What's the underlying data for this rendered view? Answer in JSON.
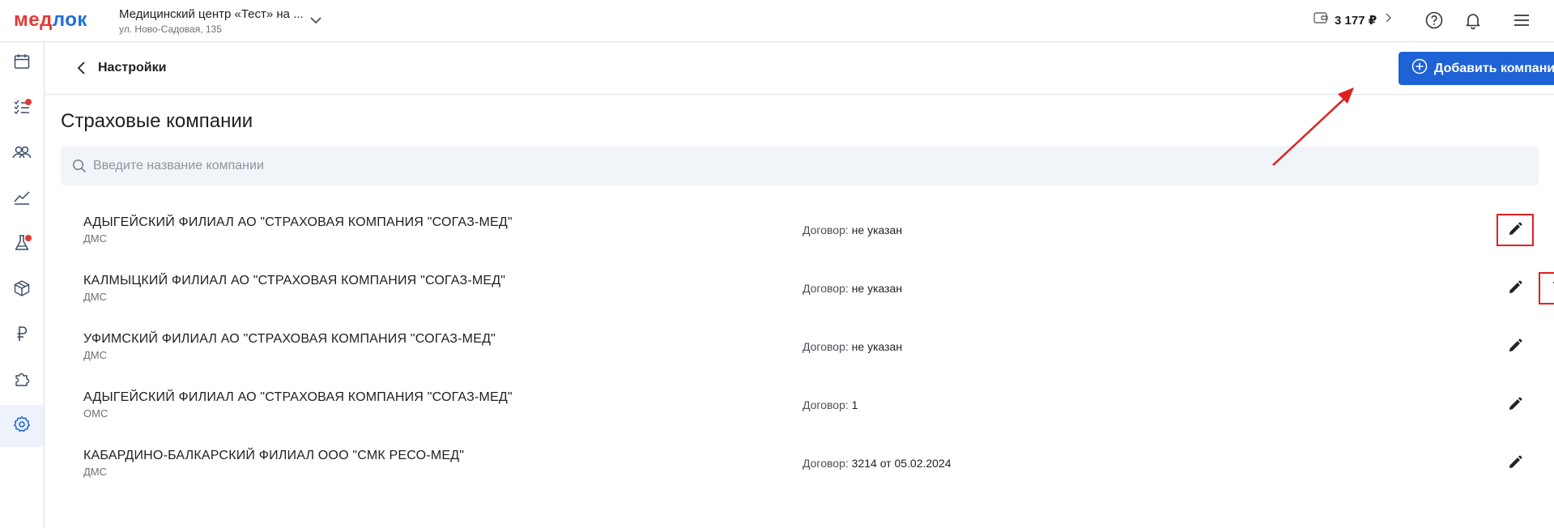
{
  "brand": {
    "logo_part1": "мед",
    "logo_part2": "лок"
  },
  "clinic": {
    "name": "Медицинский центр «Тест» на ...",
    "address": "ул. Ново-Садовая, 135"
  },
  "balance": {
    "amount": "3 177 ₽"
  },
  "header": {
    "back_label": "Настройки",
    "add_button_label": "Добавить компанию"
  },
  "page": {
    "title": "Страховые компании"
  },
  "search": {
    "placeholder": "Введите название компании",
    "value": ""
  },
  "contract_label": "Договор:",
  "companies": [
    {
      "name": "АДЫГЕЙСКИЙ ФИЛИАЛ АО \"СТРАХОВАЯ КОМПАНИЯ \"СОГАЗ-МЕД\"",
      "type": "ДМС",
      "contract": "не указан"
    },
    {
      "name": "КАЛМЫЦКИЙ ФИЛИАЛ АО \"СТРАХОВАЯ КОМПАНИЯ \"СОГАЗ-МЕД\"",
      "type": "ДМС",
      "contract": "не указан"
    },
    {
      "name": "УФИМСКИЙ ФИЛИАЛ АО \"СТРАХОВАЯ КОМПАНИЯ \"СОГАЗ-МЕД\"",
      "type": "ДМС",
      "contract": "не указан"
    },
    {
      "name": "АДЫГЕЙСКИЙ ФИЛИАЛ АО \"СТРАХОВАЯ КОМПАНИЯ \"СОГАЗ-МЕД\"",
      "type": "ОМС",
      "contract": "1"
    },
    {
      "name": "КАБАРДИНО-БАЛКАРСКИЙ ФИЛИАЛ ООО \"СМК РЕСО-МЕД\"",
      "type": "ДМС",
      "contract": "3214 от 05.02.2024"
    }
  ],
  "sidebar_icons": [
    "calendar-icon",
    "tasks-icon",
    "patients-icon",
    "analytics-icon",
    "lab-icon",
    "warehouse-icon",
    "finance-icon",
    "integrations-icon",
    "settings-icon"
  ],
  "colors": {
    "primary": "#1e62d6",
    "accent_red": "#e53935",
    "highlight": "#e02020"
  }
}
